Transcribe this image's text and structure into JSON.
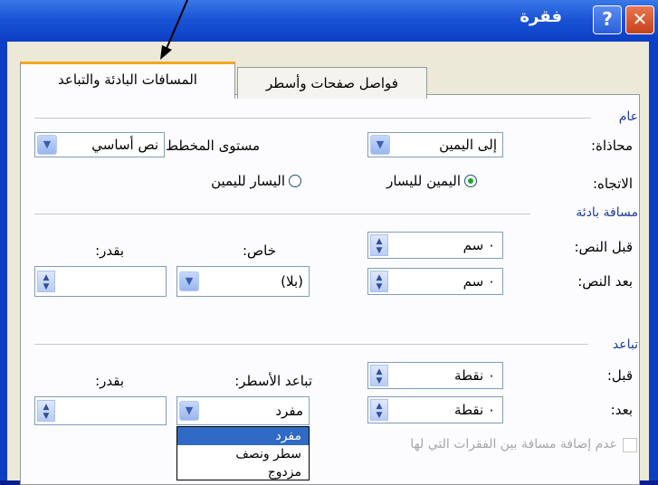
{
  "window": {
    "title": "فقرة",
    "help_label": "?",
    "close_label": "✕"
  },
  "tabs": [
    {
      "label": "المسافات البادئة والتباعد",
      "active": true
    },
    {
      "label": "فواصل صفحات وأسطر",
      "active": false
    }
  ],
  "general": {
    "section_label": "عام",
    "alignment_label": "محاذاة:",
    "alignment_value": "إلى اليمين",
    "outline_label": "مستوى المخطط:",
    "outline_value": "نص أساسي",
    "direction_label": "الاتجاه:",
    "direction_rtl_label": "اليمين لليسار",
    "direction_ltr_label": "اليسار لليمين",
    "direction_selected": "rtl"
  },
  "indent": {
    "section_label": "مسافة بادئة",
    "before_label": "قبل النص:",
    "before_value": "٠ سم",
    "after_label": "بعد النص:",
    "after_value": "٠ سم",
    "special_label": "خاص:",
    "special_value": "(بلا)",
    "by_label": "بقدر:",
    "by_value": ""
  },
  "spacing": {
    "section_label": "تباعد",
    "before_label": "قبل:",
    "before_value": "٠ نقطة",
    "after_label": "بعد:",
    "after_value": "٠ نقطة",
    "line_label": "تباعد الأسطر:",
    "line_value": "مفرد",
    "at_label": "بقدر:",
    "at_value": "",
    "dont_add_label": "عدم إضافة مسافة بين الفقرات التي لها",
    "dont_add_checked": false
  },
  "line_spacing_options": [
    "مفرد",
    "سطر ونصف",
    "مزدوج"
  ],
  "colors": {
    "title_bar": "#0a3ec4",
    "dialog_bg": "#ece9d8",
    "tab_accent": "#f5a623",
    "selection": "#316ac5"
  }
}
